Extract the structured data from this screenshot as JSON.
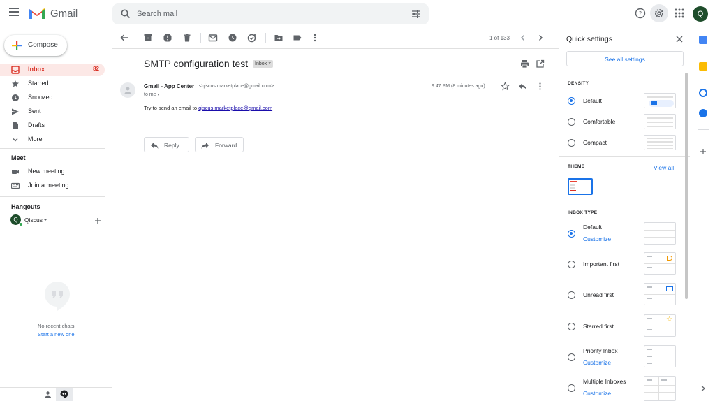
{
  "header": {
    "app_name": "Gmail",
    "search_placeholder": "Search mail",
    "avatar_letter": "Q"
  },
  "sidebar": {
    "compose_label": "Compose",
    "items": [
      {
        "label": "Inbox",
        "count": "82",
        "icon": "inbox-icon",
        "active": true
      },
      {
        "label": "Starred",
        "count": "",
        "icon": "star-icon"
      },
      {
        "label": "Snoozed",
        "count": "",
        "icon": "clock-icon"
      },
      {
        "label": "Sent",
        "count": "",
        "icon": "send-icon"
      },
      {
        "label": "Drafts",
        "count": "",
        "icon": "draft-icon"
      },
      {
        "label": "More",
        "count": "",
        "icon": "chevron-down-icon"
      }
    ],
    "meet": {
      "title": "Meet",
      "new_meeting": "New meeting",
      "join_meeting": "Join a meeting"
    },
    "hangouts": {
      "title": "Hangouts",
      "user": "Qiscus",
      "user_initial": "Q",
      "empty_text": "No recent chats",
      "start_link": "Start a new one"
    }
  },
  "toolbar": {
    "pager": "1 of 133"
  },
  "email": {
    "subject": "SMTP configuration test",
    "label_chip": "Inbox",
    "sender_name": "Gmail - App Center",
    "sender_email": "<qiscus.marketplace@gmail.com>",
    "to": "to me",
    "time": "9:47 PM (8 minutes ago)",
    "body_prefix": "Try to send an email to ",
    "body_link": "qiscus.marketplace@gmail.com",
    "reply_label": "Reply",
    "forward_label": "Forward"
  },
  "quick_settings": {
    "title": "Quick settings",
    "see_all": "See all settings",
    "density_title": "DENSITY",
    "density_options": [
      "Default",
      "Comfortable",
      "Compact"
    ],
    "density_selected": "Default",
    "theme_title": "THEME",
    "theme_view_all": "View all",
    "inbox_type_title": "INBOX TYPE",
    "inbox_types": [
      "Default",
      "Important first",
      "Unread first",
      "Starred first",
      "Priority Inbox",
      "Multiple Inboxes"
    ],
    "inbox_selected": "Default",
    "customize": "Customize"
  },
  "colors": {
    "accent_blue": "#1a73e8",
    "inbox_red": "#d93025",
    "active_bg": "#fce8e6"
  }
}
